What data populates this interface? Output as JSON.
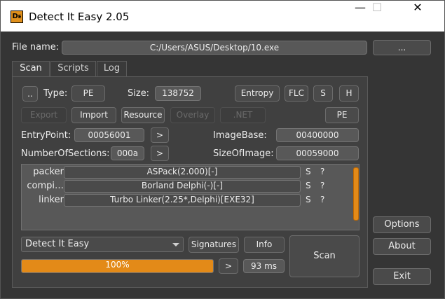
{
  "window": {
    "title": "Detect It Easy 2.05",
    "icon": "die-app-icon",
    "minimize": "—",
    "maximize": "☐",
    "close": "✕"
  },
  "file": {
    "label": "File name:",
    "path": "C:/Users/ASUS/Desktop/10.exe",
    "browse": "..."
  },
  "tabs": [
    {
      "label": "Scan",
      "active": true
    },
    {
      "label": "Scripts",
      "active": false
    },
    {
      "label": "Log",
      "active": false
    }
  ],
  "scan": {
    "up_label": "..",
    "type_label": "Type:",
    "type_value": "PE",
    "size_label": "Size:",
    "size_value": "138752",
    "entropy": "Entropy",
    "flc": "FLC",
    "s": "S",
    "h": "H",
    "export": "Export",
    "import": "Import",
    "resource": "Resource",
    "overlay": "Overlay",
    "net": ".NET",
    "pe": "PE",
    "entrypoint_label": "EntryPoint:",
    "entrypoint_value": "00056001",
    "imagebase_label": "ImageBase:",
    "imagebase_value": "00400000",
    "sections_label": "NumberOfSections:",
    "sections_value": "000a",
    "sizeofimage_label": "SizeOfImage:",
    "sizeofimage_value": "00059000",
    "go": ">"
  },
  "results": [
    {
      "type": "packer",
      "name": "ASPack(2.000)[-]",
      "s": "S",
      "q": "?"
    },
    {
      "type": "compi…",
      "name": "Borland Delphi(-)[-]",
      "s": "S",
      "q": "?"
    },
    {
      "type": "linker",
      "name": "Turbo Linker(2.25*,Delphi)[EXE32]",
      "s": "S",
      "q": "?"
    }
  ],
  "bottom": {
    "engine": "Detect It Easy",
    "signatures": "Signatures",
    "info": "Info",
    "scan": "Scan",
    "progress_text": "100%",
    "progress_fraction": 1.0,
    "next": ">",
    "time": "93 ms"
  },
  "side": {
    "options": "Options",
    "about": "About",
    "exit": "Exit"
  },
  "colors": {
    "accent": "#e38a18",
    "background": "#353535",
    "field": "#585858"
  }
}
